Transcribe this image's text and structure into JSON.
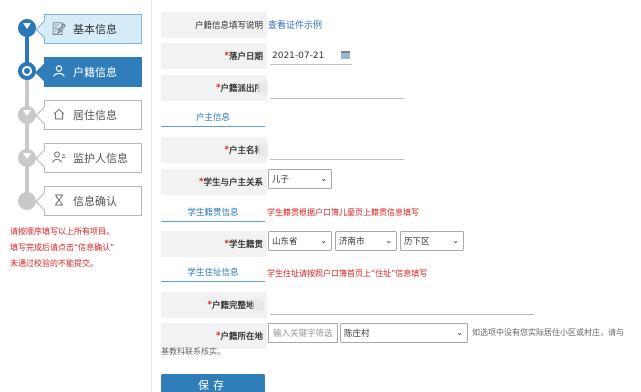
{
  "steps": [
    {
      "label": "基本信息",
      "icon": "document-edit-icon"
    },
    {
      "label": "户籍信息",
      "icon": "user-icon"
    },
    {
      "label": "居住信息",
      "icon": "home-icon"
    },
    {
      "label": "监护人信息",
      "icon": "guardian-icon"
    },
    {
      "label": "信息确认",
      "icon": "hourglass-icon"
    }
  ],
  "tips": [
    "请按顺序填写以上所有项目。",
    "填写完成后请点击“信息确认”",
    "未通过校验的不能提交。"
  ],
  "form": {
    "instructions_label": "户籍信息填写说明",
    "instructions_link": "查看证件示例",
    "settle_date_label": "落户日期",
    "settle_date_value": "2021-07-21",
    "police_station_label": "户籍派出所",
    "household_head_section": "户主信息",
    "head_name_label": "户主名称",
    "relation_label": "学生与户主关系",
    "relation_value": "儿子",
    "native_section": "学生籍贯信息",
    "native_note": "学生籍贯根据户口簿儿童页上籍贯信息填写",
    "native_label": "学生籍贯",
    "province": "山东省",
    "city": "济南市",
    "district": "历下区",
    "address_section": "学生住址信息",
    "address_note": "学生住址请按照户口簿首页上“住址”信息填写",
    "full_address_label": "户籍完整地址",
    "location_label": "户籍所在地",
    "keyword_placeholder": "输入关键字筛选",
    "village_value": "陈庄村",
    "location_hint_1": "如选项中没有您实际居住小区或村庄，请与",
    "location_hint_2": "基教科联系核实。",
    "save_label": "保存"
  },
  "colors": {
    "accent": "#2f7db9",
    "required": "#e02020",
    "link": "#2b6fcf",
    "label_bg": "#f2f2f2"
  }
}
